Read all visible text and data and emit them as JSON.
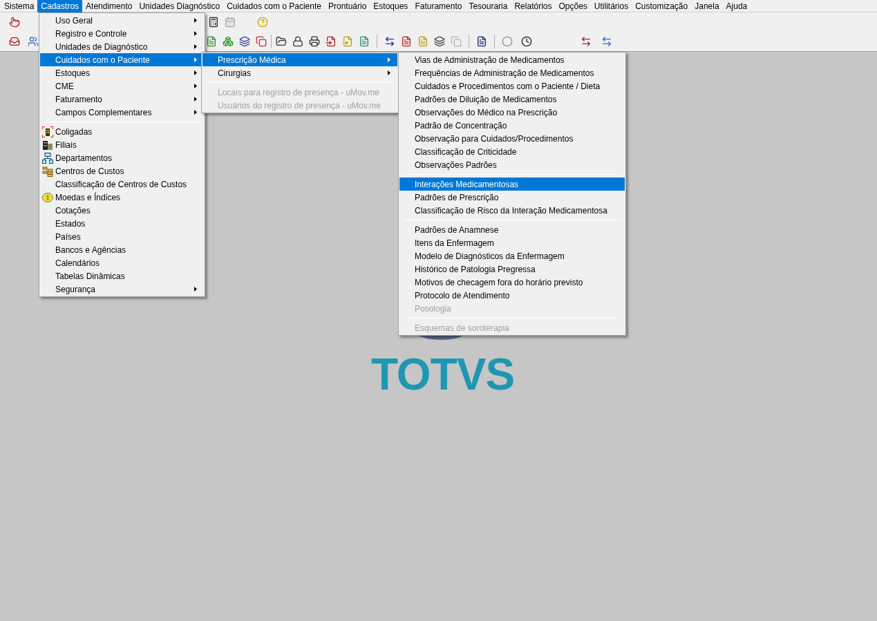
{
  "menu_bar": [
    {
      "label": "Sistema",
      "selected": false
    },
    {
      "label": "Cadastros",
      "selected": true
    },
    {
      "label": "Atendimento",
      "selected": false
    },
    {
      "label": "Unidades Diagnóstico",
      "selected": false
    },
    {
      "label": "Cuidados com o Paciente",
      "selected": false
    },
    {
      "label": "Prontuário",
      "selected": false
    },
    {
      "label": "Estoques",
      "selected": false
    },
    {
      "label": "Faturamento",
      "selected": false
    },
    {
      "label": "Tesouraria",
      "selected": false
    },
    {
      "label": "Relatórios",
      "selected": false
    },
    {
      "label": "Opções",
      "selected": false
    },
    {
      "label": "Utilitários",
      "selected": false
    },
    {
      "label": "Customização",
      "selected": false
    },
    {
      "label": "Janela",
      "selected": false
    },
    {
      "label": "Ajuda",
      "selected": false
    }
  ],
  "cadastros_menu": [
    {
      "kind": "submenu",
      "label": "Uso Geral",
      "selected": false,
      "disabled": false
    },
    {
      "kind": "submenu",
      "label": "Registro e Controle",
      "selected": false,
      "disabled": false
    },
    {
      "kind": "submenu",
      "label": "Unidades de Diagnóstico",
      "selected": false,
      "disabled": false
    },
    {
      "kind": "submenu",
      "label": "Cuidados com o Paciente",
      "selected": true,
      "disabled": false
    },
    {
      "kind": "submenu",
      "label": "Estoques",
      "selected": false,
      "disabled": false
    },
    {
      "kind": "submenu",
      "label": "CME",
      "selected": false,
      "disabled": false
    },
    {
      "kind": "submenu",
      "label": "Faturamento",
      "selected": false,
      "disabled": false
    },
    {
      "kind": "submenu",
      "label": "Campos Complementares",
      "selected": false,
      "disabled": false
    },
    {
      "kind": "separator"
    },
    {
      "kind": "item",
      "label": "Coligadas",
      "selected": false,
      "disabled": false
    },
    {
      "kind": "item",
      "label": "Filiais",
      "selected": false,
      "disabled": false
    },
    {
      "kind": "item",
      "label": "Departamentos",
      "selected": false,
      "disabled": false
    },
    {
      "kind": "item",
      "label": "Centros de Custos",
      "selected": false,
      "disabled": false
    },
    {
      "kind": "item",
      "label": "Classificação de Centros de Custos",
      "selected": false,
      "disabled": false
    },
    {
      "kind": "item",
      "label": "Moedas e Índices",
      "selected": false,
      "disabled": false
    },
    {
      "kind": "item",
      "label": "Cotações",
      "selected": false,
      "disabled": false
    },
    {
      "kind": "item",
      "label": "Estados",
      "selected": false,
      "disabled": false
    },
    {
      "kind": "item",
      "label": "Países",
      "selected": false,
      "disabled": false
    },
    {
      "kind": "item",
      "label": "Bancos e Agências",
      "selected": false,
      "disabled": false
    },
    {
      "kind": "item",
      "label": "Calendários",
      "selected": false,
      "disabled": false
    },
    {
      "kind": "item",
      "label": "Tabelas Dinâmicas",
      "selected": false,
      "disabled": false
    },
    {
      "kind": "submenu",
      "label": "Segurança",
      "selected": false,
      "disabled": false
    }
  ],
  "cuidados_menu": [
    {
      "kind": "submenu",
      "label": "Prescrição Médica",
      "selected": true,
      "disabled": false
    },
    {
      "kind": "submenu",
      "label": "Cirurgias",
      "selected": false,
      "disabled": false
    },
    {
      "kind": "separator"
    },
    {
      "kind": "item",
      "label": "Locais para registro de presença - uMov.me",
      "selected": false,
      "disabled": true
    },
    {
      "kind": "item",
      "label": "Usuários do registro de presença - uMov.me",
      "selected": false,
      "disabled": true
    }
  ],
  "prescricao_menu": [
    {
      "kind": "item",
      "label": "Vias de Administração de Medicamentos",
      "selected": false,
      "disabled": false
    },
    {
      "kind": "item",
      "label": "Frequências de Administração de Medicamentos",
      "selected": false,
      "disabled": false
    },
    {
      "kind": "item",
      "label": "Cuidados e Procedimentos com o Paciente / Dieta",
      "selected": false,
      "disabled": false
    },
    {
      "kind": "item",
      "label": "Padrões de Diluição de Medicamentos",
      "selected": false,
      "disabled": false
    },
    {
      "kind": "item",
      "label": "Observações do Médico na Prescrição",
      "selected": false,
      "disabled": false
    },
    {
      "kind": "item",
      "label": "Padrão de Concentração",
      "selected": false,
      "disabled": false
    },
    {
      "kind": "item",
      "label": "Observação para Cuidados/Procedimentos",
      "selected": false,
      "disabled": false
    },
    {
      "kind": "item",
      "label": "Classificação de Criticidade",
      "selected": false,
      "disabled": false
    },
    {
      "kind": "item",
      "label": "Observações Padrões",
      "selected": false,
      "disabled": false
    },
    {
      "kind": "separator"
    },
    {
      "kind": "item",
      "label": "Interações Medicamentosas",
      "selected": true,
      "disabled": false
    },
    {
      "kind": "item",
      "label": "Padrões de Prescrição",
      "selected": false,
      "disabled": false
    },
    {
      "kind": "item",
      "label": "Classificação de Risco da Interação Medicamentosa",
      "selected": false,
      "disabled": false
    },
    {
      "kind": "separator"
    },
    {
      "kind": "item",
      "label": "Padrões de Anamnese",
      "selected": false,
      "disabled": false
    },
    {
      "kind": "item",
      "label": "Itens da Enfermagem",
      "selected": false,
      "disabled": false
    },
    {
      "kind": "item",
      "label": "Modelo de Diagnósticos da Enfermagem",
      "selected": false,
      "disabled": false
    },
    {
      "kind": "item",
      "label": "Histórico de Patologia Pregressa",
      "selected": false,
      "disabled": false
    },
    {
      "kind": "item",
      "label": "Motivos de checagem fora do horário previsto",
      "selected": false,
      "disabled": false
    },
    {
      "kind": "item",
      "label": "Protocolo de Atendimento",
      "selected": false,
      "disabled": false
    },
    {
      "kind": "item",
      "label": "Posologia",
      "selected": false,
      "disabled": true
    },
    {
      "kind": "separator"
    },
    {
      "kind": "item",
      "label": "Esquemas de soroterapia",
      "selected": false,
      "disabled": true
    }
  ],
  "logo": {
    "text": "TOTVS"
  }
}
